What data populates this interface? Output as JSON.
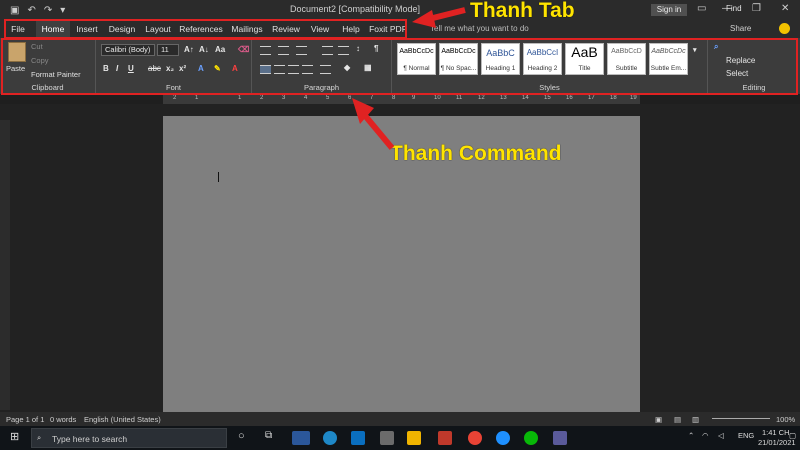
{
  "titlebar": {
    "document_title": "Document2 [Compatibility Mode] - Word",
    "sign_in": "Sign in"
  },
  "tabs": [
    "File",
    "Home",
    "Insert",
    "Design",
    "Layout",
    "References",
    "Mailings",
    "Review",
    "View",
    "Help",
    "Foxit PDF"
  ],
  "active_tab": "Home",
  "tell_me": "Tell me what you want to do",
  "share": "Share",
  "clipboard": {
    "paste": "Paste",
    "cut": "Cut",
    "copy": "Copy",
    "format_painter": "Format Painter",
    "label": "Clipboard"
  },
  "font": {
    "font_name": "Calibri (Body)",
    "font_size": "11",
    "label": "Font"
  },
  "paragraph": {
    "label": "Paragraph"
  },
  "styles": {
    "label": "Styles",
    "cards": [
      {
        "sample": "AaBbCcDc",
        "name": "¶ Normal"
      },
      {
        "sample": "AaBbCcDc",
        "name": "¶ No Spac..."
      },
      {
        "sample": "AaBbC",
        "name": "Heading 1"
      },
      {
        "sample": "AaBbCcI",
        "name": "Heading 2"
      },
      {
        "sample": "AaB",
        "name": "Title"
      },
      {
        "sample": "AaBbCcD",
        "name": "Subtitle"
      },
      {
        "sample": "AaBbCcDc",
        "name": "Subtle Em..."
      }
    ]
  },
  "editing": {
    "find": "Find",
    "replace": "Replace",
    "select": "Select",
    "label": "Editing"
  },
  "ruler_numbers": [
    "2",
    "1",
    "1",
    "2",
    "3",
    "4",
    "5",
    "6",
    "7",
    "8",
    "9",
    "10",
    "11",
    "12",
    "13",
    "14",
    "15",
    "16",
    "17",
    "18",
    "19"
  ],
  "statusbar": {
    "page": "Page 1 of 1",
    "words": "0 words",
    "language": "English (United States)",
    "zoom": "100%"
  },
  "taskbar": {
    "search_placeholder": "Type here to search",
    "language": "ENG",
    "time": "1:41 CH",
    "date": "21/01/2021"
  },
  "annotations": {
    "tab_label": "Thanh Tab",
    "command_label": "Thanh Command",
    "color": "#e02222",
    "text_color": "#ffe400"
  }
}
